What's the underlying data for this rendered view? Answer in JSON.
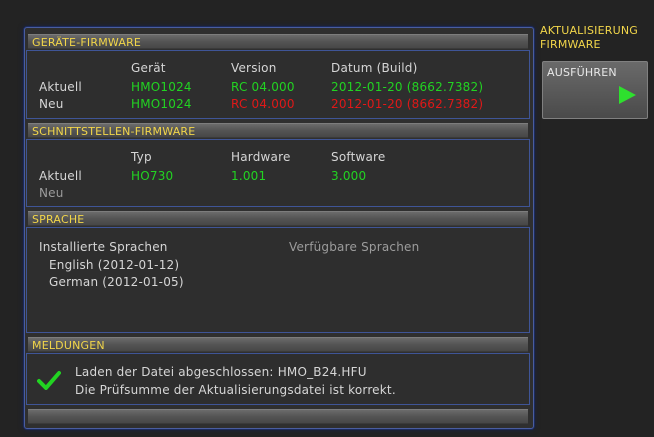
{
  "firmware": {
    "header": "GERÄTE-FIRMWARE",
    "col_device": "Gerät",
    "col_version": "Version",
    "col_date": "Datum (Build)",
    "current_label": "Aktuell",
    "new_label": "Neu",
    "current": {
      "device": "HMO1024",
      "version": "RC 04.000",
      "date": "2012-01-20 (8662.7382)"
    },
    "new": {
      "device": "HMO1024",
      "version": "RC 04.000",
      "date": "2012-01-20 (8662.7382)"
    }
  },
  "interface": {
    "header": "SCHNITTSTELLEN-FIRMWARE",
    "col_type": "Typ",
    "col_hardware": "Hardware",
    "col_software": "Software",
    "current_label": "Aktuell",
    "new_label": "Neu",
    "current": {
      "type": "HO730",
      "hardware": "1.001",
      "software": "3.000"
    }
  },
  "language": {
    "header": "SPRACHE",
    "installed_label": "Installierte Sprachen",
    "available_label": "Verfügbare Sprachen",
    "installed": [
      "English (2012-01-12)",
      "German (2012-01-05)"
    ]
  },
  "messages": {
    "header": "MELDUNGEN",
    "line1": "Laden der Datei abgeschlossen: HMO_B24.HFU",
    "line2": "Die Prüfsumme der Aktualisierungsdatei ist korrekt.",
    "status_icon": "check-icon"
  },
  "side": {
    "title_line1": "AKTUALISIERUNG",
    "title_line2": "FIRMWARE",
    "execute_label": "AUSFÜHREN",
    "execute_icon": "play-icon"
  },
  "colors": {
    "accent_yellow": "#f2d64a",
    "ok_green": "#22d322",
    "error_red": "#e01818",
    "frame_blue": "#3f5597"
  }
}
